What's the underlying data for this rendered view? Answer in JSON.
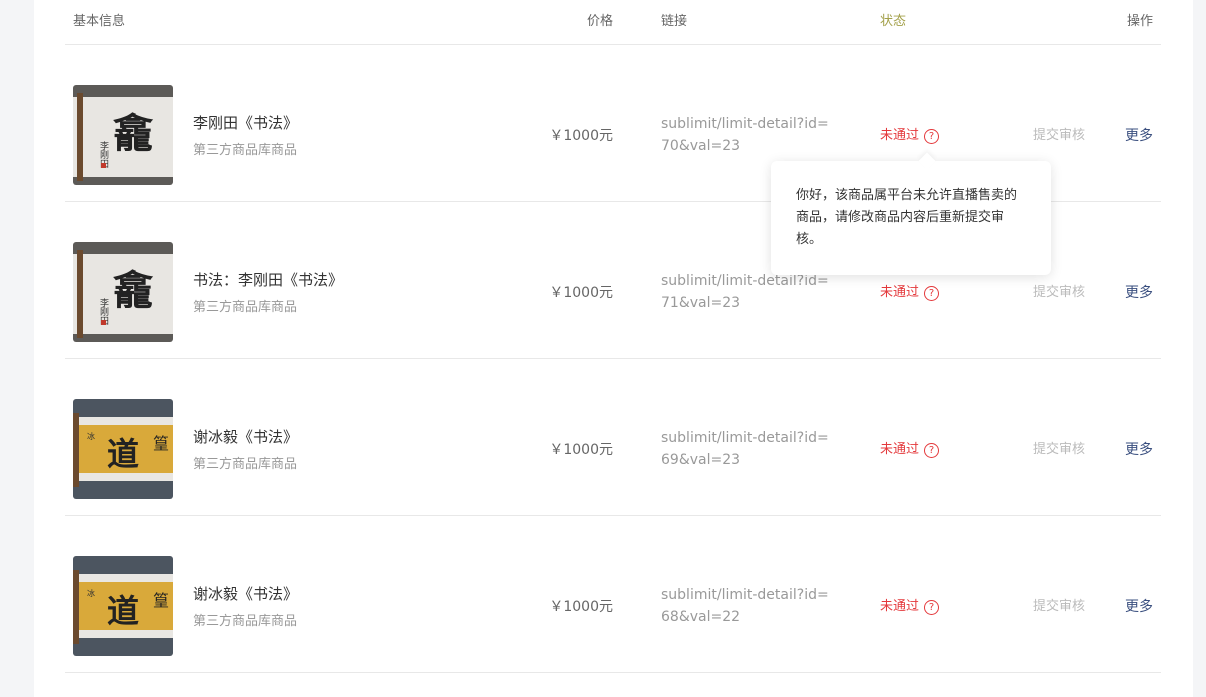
{
  "header": {
    "info": "基本信息",
    "price": "价格",
    "link": "链接",
    "status": "状态",
    "op": "操作"
  },
  "rows": [
    {
      "title": "李刚田《书法》",
      "sub": "第三方商品库商品",
      "price": "￥1000元",
      "link": "sublimit/limit-detail?id=70&val=23",
      "status": "未通过",
      "submit": "提交审核",
      "more": "更多",
      "thumb": "white-calligraphy",
      "calligraphy": "龕"
    },
    {
      "title": "书法：李刚田《书法》",
      "sub": "第三方商品库商品",
      "price": "￥1000元",
      "link": "sublimit/limit-detail?id=71&val=23",
      "status": "未通过",
      "submit": "提交审核",
      "more": "更多",
      "thumb": "white-calligraphy",
      "calligraphy": "龕"
    },
    {
      "title": "谢冰毅《书法》",
      "sub": "第三方商品库商品",
      "price": "￥1000元",
      "link": "sublimit/limit-detail?id=69&val=23",
      "status": "未通过",
      "submit": "提交审核",
      "more": "更多",
      "thumb": "yellow-calligraphy",
      "calligraphy": "道"
    },
    {
      "title": "谢冰毅《书法》",
      "sub": "第三方商品库商品",
      "price": "￥1000元",
      "link": "sublimit/limit-detail?id=68&val=22",
      "status": "未通过",
      "submit": "提交审核",
      "more": "更多",
      "thumb": "yellow-calligraphy",
      "calligraphy": "道"
    }
  ],
  "tooltip": {
    "text": "你好，该商品属平台未允许直播售卖的商品，请修改商品内容后重新提交审核。"
  },
  "icons": {
    "status_help": "question-circle-icon"
  },
  "colors": {
    "status_fail": "#e4393c",
    "more_link": "#3a4f7f",
    "status_header": "#a3a04a"
  }
}
